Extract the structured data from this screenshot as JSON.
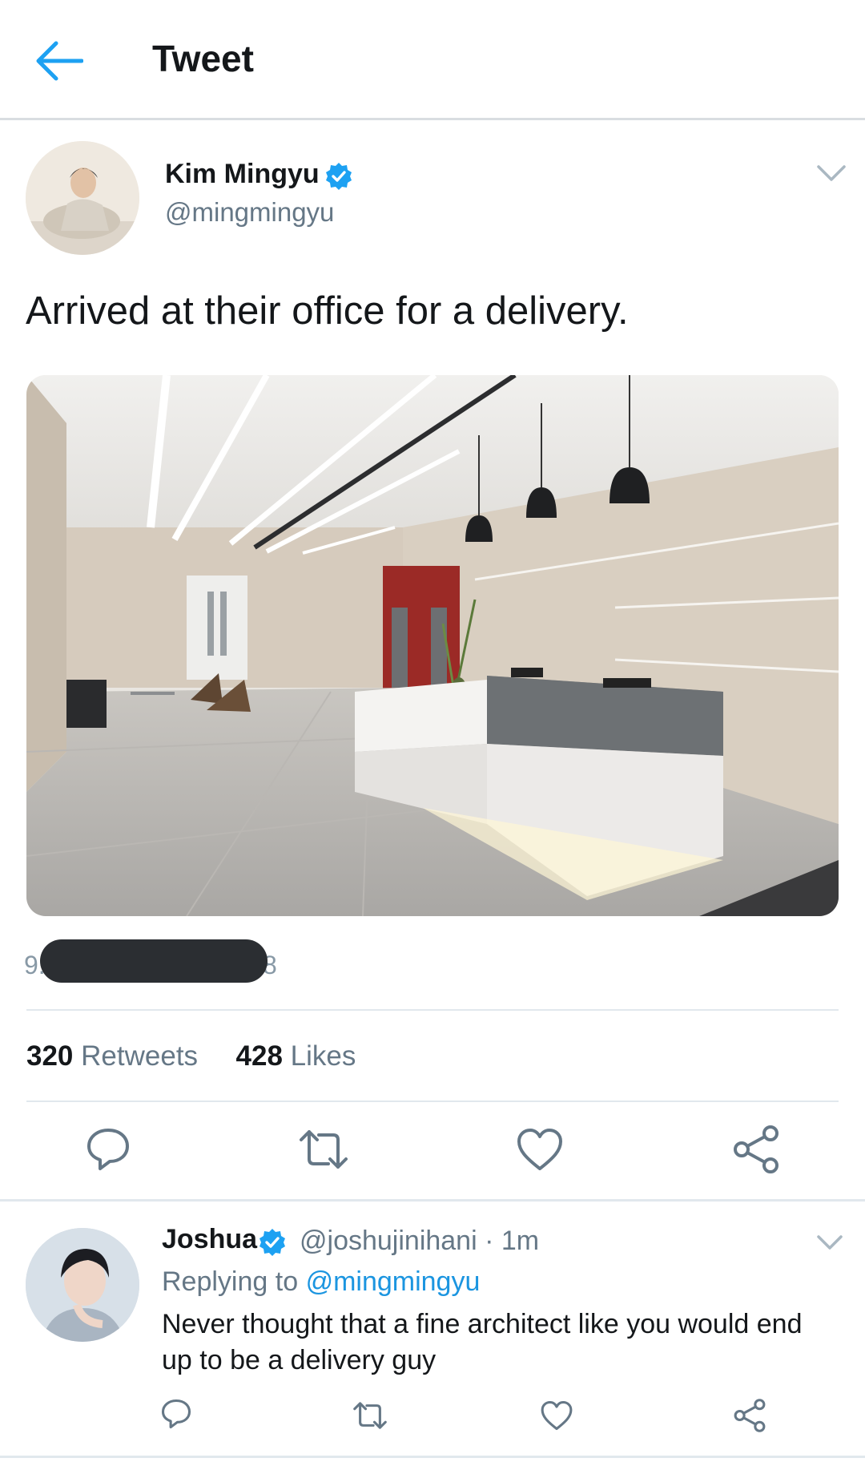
{
  "header": {
    "title": "Tweet",
    "back_icon": "arrow-left-icon"
  },
  "tweet": {
    "author_name": "Kim Mingyu",
    "author_handle": "@mingmingyu",
    "text": "Arrived at their office for a delivery.",
    "timestamp_start": "9.",
    "timestamp_end": "8",
    "retweets_count": "320",
    "retweets_label": "Retweets",
    "likes_count": "428",
    "likes_label": "Likes"
  },
  "reply": {
    "author_name": "Joshua",
    "author_handle": "@joshujinihani · 1m",
    "replying_prefix": "Replying to",
    "replying_to": "@mingmingyu",
    "text": "Never thought that a fine architect like you would end up to be a delivery guy"
  },
  "colors": {
    "accent": "#1da1f2",
    "icon_gray": "#657786",
    "divider": "#e1e8ed"
  }
}
